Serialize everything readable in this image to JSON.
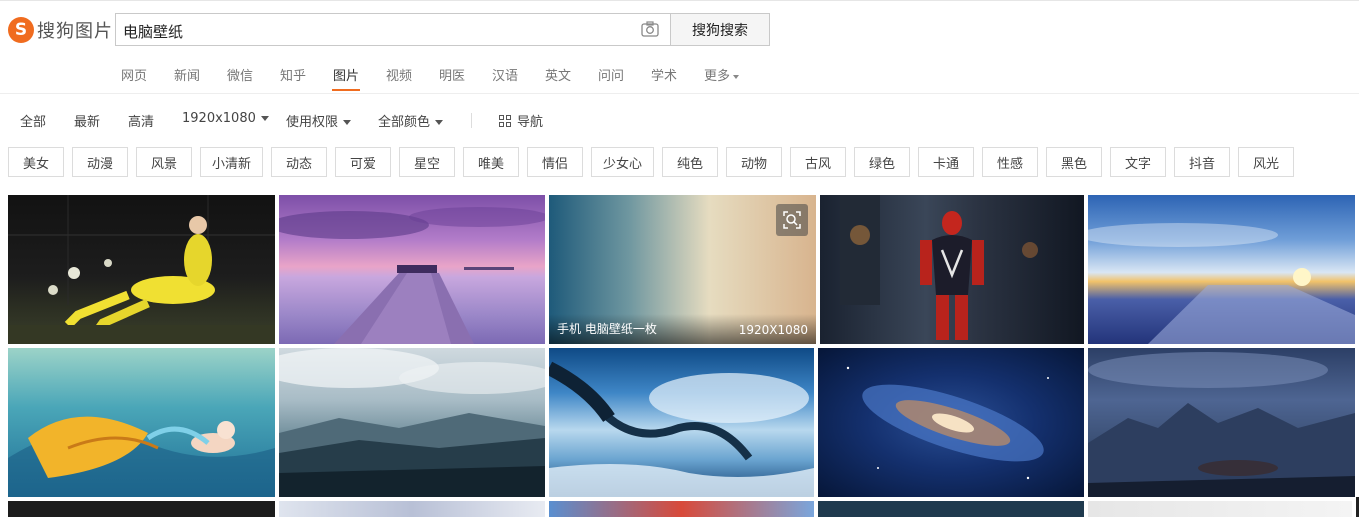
{
  "logo": {
    "mark": "S",
    "text": "搜狗图片"
  },
  "search": {
    "query": "电脑壁纸",
    "button": "搜狗搜索",
    "camera_icon": "camera-icon"
  },
  "nav": {
    "items": [
      "网页",
      "新闻",
      "微信",
      "知乎",
      "图片",
      "视频",
      "明医",
      "汉语",
      "英文",
      "问问",
      "学术",
      "更多"
    ],
    "active": "图片"
  },
  "filters": {
    "all": "全部",
    "latest": "最新",
    "hd": "高清",
    "resolution": "1920x1080",
    "license": "使用权限",
    "color": "全部颜色",
    "guide": "导航"
  },
  "tags": [
    "美女",
    "动漫",
    "风景",
    "小清新",
    "动态",
    "可爱",
    "星空",
    "唯美",
    "情侣",
    "少女心",
    "纯色",
    "动物",
    "古风",
    "绿色",
    "卡通",
    "性感",
    "黑色",
    "文字",
    "抖音",
    "风光"
  ],
  "images": [
    {
      "kind": "soccer-player-photo",
      "title": "",
      "resolution": ""
    },
    {
      "kind": "purple-sunset-pier",
      "title": "",
      "resolution": ""
    },
    {
      "kind": "teal-peach-gradient",
      "title": "手机 电脑壁纸一枚",
      "resolution": "1920X1080"
    },
    {
      "kind": "spiderman-night-street",
      "title": "",
      "resolution": ""
    },
    {
      "kind": "sunset-water-road",
      "title": "",
      "resolution": ""
    },
    {
      "kind": "mermaid-illustration",
      "title": "",
      "resolution": ""
    },
    {
      "kind": "misty-mountains",
      "title": "",
      "resolution": ""
    },
    {
      "kind": "anime-tree-sky",
      "title": "",
      "resolution": ""
    },
    {
      "kind": "galaxy-space",
      "title": "",
      "resolution": ""
    },
    {
      "kind": "night-mountain-landscape",
      "title": "",
      "resolution": ""
    }
  ],
  "colors": {
    "accent": "#f06c1f"
  }
}
